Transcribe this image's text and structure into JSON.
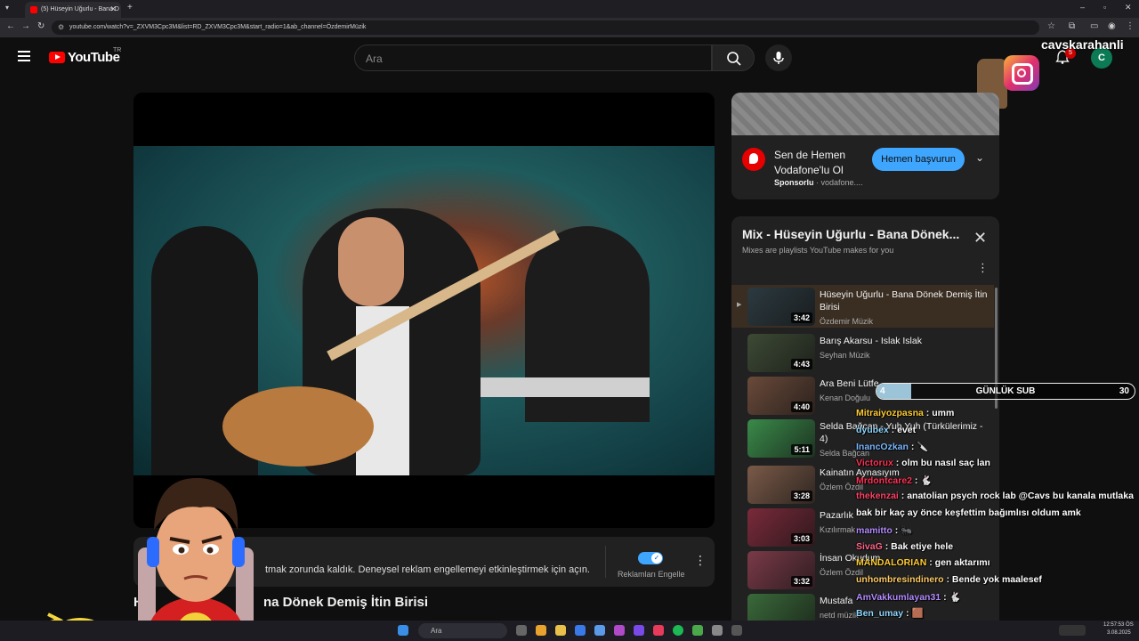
{
  "browser": {
    "tab_title": "(5) Hüseyin Uğurlu - Bana D",
    "tab_close": "✕",
    "new_tab": "+",
    "url": "youtube.com/watch?v=_ZXVM3Cpc3M&list=RD_ZXVM3Cpc3M&start_radio=1&ab_channel=ÖzdemirMüzik"
  },
  "header": {
    "logo_text": "YouTube",
    "region": "TR",
    "search_placeholder": "Ara",
    "notification_count": "5",
    "avatar_letter": "C"
  },
  "overlay": {
    "instagram_handle": "cavskarahanli",
    "sub_goal_label": "GÜNLÜK SUB",
    "sub_current": "4",
    "sub_target": "30",
    "sub_progress": 0.133
  },
  "adblock": {
    "message": "tmak zorunda kaldık. Deneysel reklam engellemeyi etkinleştirmek için açın.",
    "toggle_label": "Reklamları Engelle"
  },
  "video": {
    "title_start": "Hi",
    "title_end": "na Dönek Demiş İtin Birisi"
  },
  "sponsor": {
    "line1": "Sen de Hemen",
    "line2": "Vodafone'lu Ol",
    "sponsored_label": "Sponsorlu",
    "domain": " · vodafone....",
    "cta": "Hemen başvurun"
  },
  "mix": {
    "title": "Mix - Hüseyin Uğurlu - Bana Dönek...",
    "subtitle": "Mixes are playlists YouTube makes for you",
    "items": [
      {
        "title": "Hüseyin Uğurlu - Bana Dönek Demiş İtin Birisi",
        "channel": "Özdemir Müzik",
        "duration": "3:42",
        "color": "#2c3a40"
      },
      {
        "title": "Barış Akarsu - Islak Islak",
        "channel": "Seyhan Müzik",
        "duration": "4:43",
        "color": "#3d4a35"
      },
      {
        "title": "Ara Beni Lütfe",
        "channel": "Kenan Doğulu",
        "duration": "4:40",
        "color": "#6a4a3a"
      },
      {
        "title": "Selda Bağcan - Yuh Yuh (Türkülerimiz - 4)",
        "channel": "Selda Bağcan",
        "duration": "5:11",
        "color": "#3a8a4a"
      },
      {
        "title": "Kainatın Aynasıyım",
        "channel": "Özlem Özdil",
        "duration": "3:28",
        "color": "#7a5a48"
      },
      {
        "title": "Pazarlık",
        "channel": "Kızılırmak",
        "duration": "3:03",
        "color": "#7a2a3a"
      },
      {
        "title": "İnsan Okudum",
        "channel": "Özlem Özdil",
        "duration": "3:32",
        "color": "#7a3a48"
      },
      {
        "title": "Mustafa",
        "channel": "netd müzik",
        "duration": "",
        "color": "#3a6a3a"
      }
    ]
  },
  "chat": [
    {
      "user": "Mitraiyozpasna",
      "color": "#ffcc33",
      "msg": " : umm"
    },
    {
      "user": "dyubex",
      "color": "#8fd6ff",
      "msg": " : evet"
    },
    {
      "user": "InancOzkan",
      "color": "#7ab8ff",
      "msg": " : 🔪"
    },
    {
      "user": "Victorux",
      "color": "#ff3355",
      "msg": " : olm bu nasıl saç lan"
    },
    {
      "user": "Mrdontcare2",
      "color": "#ff3355",
      "msg": " : 🐇"
    },
    {
      "user": "thekenzai",
      "color": "#ff4466",
      "msg": " : anatolian psych rock lab @Cavs bu kanala mutlaka"
    },
    {
      "user": "",
      "color": "#ffffff",
      "msg": "bak bir kaç ay önce keşfettim bağımlısı oldum amk"
    },
    {
      "user": "mamitto",
      "color": "#b48cff",
      "msg": " : 🐜"
    },
    {
      "user": "SivaG",
      "color": "#ff6688",
      "msg": " : Bak etiye hele"
    },
    {
      "user": "MANDALORIAN",
      "color": "#ffcc33",
      "msg": " : gen aktarımı"
    },
    {
      "user": "unhombresindinero",
      "color": "#ffcc66",
      "msg": " : Bende yok maalesef"
    },
    {
      "user": "AmVakkumlayan31",
      "color": "#b48cff",
      "msg": " : 🐇"
    },
    {
      "user": "Ben_umay",
      "color": "#8fd6ff",
      "msg": " : 🟫"
    }
  ],
  "taskbar": {
    "search": "Ara",
    "time": "12:57:53 ÖS",
    "date": "3.08.2025"
  },
  "colors": {
    "accent_blue": "#3ea6ff",
    "youtube_red": "#ff0000",
    "vodafone_red": "#e60000"
  }
}
